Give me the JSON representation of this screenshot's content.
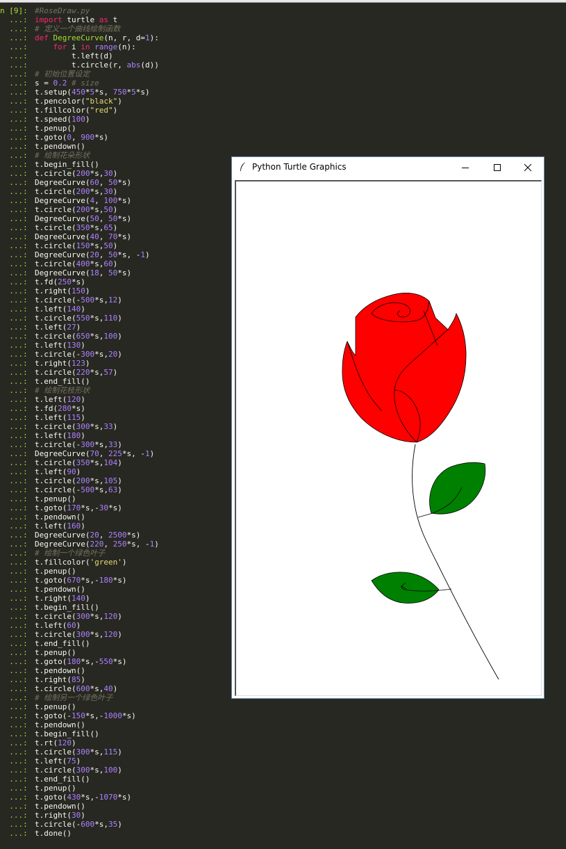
{
  "console": {
    "first_prompt": "n [9]:",
    "cont_prompt": "...:",
    "lines": [
      [
        [
          "com",
          "#RoseDraw.py"
        ]
      ],
      [
        [
          "kw",
          "import"
        ],
        [
          "txt",
          " turtle "
        ],
        [
          "kw",
          "as"
        ],
        [
          "txt",
          " t"
        ]
      ],
      [
        [
          "com",
          "# 定义一个曲线绘制函数"
        ]
      ],
      [
        [
          "kw",
          "def"
        ],
        [
          "txt",
          " "
        ],
        [
          "fn",
          "DegreeCurve"
        ],
        [
          "txt",
          "(n, r, d="
        ],
        [
          "num",
          "1"
        ],
        [
          "txt",
          "):"
        ]
      ],
      [
        [
          "txt",
          "    "
        ],
        [
          "kw",
          "for"
        ],
        [
          "txt",
          " i "
        ],
        [
          "kw",
          "in"
        ],
        [
          "txt",
          " "
        ],
        [
          "bi",
          "range"
        ],
        [
          "txt",
          "(n):"
        ]
      ],
      [
        [
          "txt",
          "        t.left(d)"
        ]
      ],
      [
        [
          "txt",
          "        t.circle(r, "
        ],
        [
          "bi",
          "abs"
        ],
        [
          "txt",
          "(d))"
        ]
      ],
      [
        [
          "com",
          "# 初始位置设定"
        ]
      ],
      [
        [
          "txt",
          "s = "
        ],
        [
          "num",
          "0.2"
        ],
        [
          "txt",
          " "
        ],
        [
          "com",
          "# size"
        ]
      ],
      [
        [
          "txt",
          "t.setup("
        ],
        [
          "num",
          "450"
        ],
        [
          "txt",
          "*"
        ],
        [
          "num",
          "5"
        ],
        [
          "txt",
          "*s, "
        ],
        [
          "num",
          "750"
        ],
        [
          "txt",
          "*"
        ],
        [
          "num",
          "5"
        ],
        [
          "txt",
          "*s)"
        ]
      ],
      [
        [
          "txt",
          "t.pencolor("
        ],
        [
          "str",
          "\"black\""
        ],
        [
          "txt",
          ")"
        ]
      ],
      [
        [
          "txt",
          "t.fillcolor("
        ],
        [
          "str",
          "\"red\""
        ],
        [
          "txt",
          ")"
        ]
      ],
      [
        [
          "txt",
          "t.speed("
        ],
        [
          "num",
          "100"
        ],
        [
          "txt",
          ")"
        ]
      ],
      [
        [
          "txt",
          "t.penup()"
        ]
      ],
      [
        [
          "txt",
          "t.goto("
        ],
        [
          "num",
          "0"
        ],
        [
          "txt",
          ", "
        ],
        [
          "num",
          "900"
        ],
        [
          "txt",
          "*s)"
        ]
      ],
      [
        [
          "txt",
          "t.pendown()"
        ]
      ],
      [
        [
          "com",
          "# 绘制花朵形状"
        ]
      ],
      [
        [
          "txt",
          "t.begin_fill()"
        ]
      ],
      [
        [
          "txt",
          "t.circle("
        ],
        [
          "num",
          "200"
        ],
        [
          "txt",
          "*s,"
        ],
        [
          "num",
          "30"
        ],
        [
          "txt",
          ")"
        ]
      ],
      [
        [
          "txt",
          "DegreeCurve("
        ],
        [
          "num",
          "60"
        ],
        [
          "txt",
          ", "
        ],
        [
          "num",
          "50"
        ],
        [
          "txt",
          "*s)"
        ]
      ],
      [
        [
          "txt",
          "t.circle("
        ],
        [
          "num",
          "200"
        ],
        [
          "txt",
          "*s,"
        ],
        [
          "num",
          "30"
        ],
        [
          "txt",
          ")"
        ]
      ],
      [
        [
          "txt",
          "DegreeCurve("
        ],
        [
          "num",
          "4"
        ],
        [
          "txt",
          ", "
        ],
        [
          "num",
          "100"
        ],
        [
          "txt",
          "*s)"
        ]
      ],
      [
        [
          "txt",
          "t.circle("
        ],
        [
          "num",
          "200"
        ],
        [
          "txt",
          "*s,"
        ],
        [
          "num",
          "50"
        ],
        [
          "txt",
          ")"
        ]
      ],
      [
        [
          "txt",
          "DegreeCurve("
        ],
        [
          "num",
          "50"
        ],
        [
          "txt",
          ", "
        ],
        [
          "num",
          "50"
        ],
        [
          "txt",
          "*s)"
        ]
      ],
      [
        [
          "txt",
          "t.circle("
        ],
        [
          "num",
          "350"
        ],
        [
          "txt",
          "*s,"
        ],
        [
          "num",
          "65"
        ],
        [
          "txt",
          ")"
        ]
      ],
      [
        [
          "txt",
          "DegreeCurve("
        ],
        [
          "num",
          "40"
        ],
        [
          "txt",
          ", "
        ],
        [
          "num",
          "70"
        ],
        [
          "txt",
          "*s)"
        ]
      ],
      [
        [
          "txt",
          "t.circle("
        ],
        [
          "num",
          "150"
        ],
        [
          "txt",
          "*s,"
        ],
        [
          "num",
          "50"
        ],
        [
          "txt",
          ")"
        ]
      ],
      [
        [
          "txt",
          "DegreeCurve("
        ],
        [
          "num",
          "20"
        ],
        [
          "txt",
          ", "
        ],
        [
          "num",
          "50"
        ],
        [
          "txt",
          "*s, -"
        ],
        [
          "num",
          "1"
        ],
        [
          "txt",
          ")"
        ]
      ],
      [
        [
          "txt",
          "t.circle("
        ],
        [
          "num",
          "400"
        ],
        [
          "txt",
          "*s,"
        ],
        [
          "num",
          "60"
        ],
        [
          "txt",
          ")"
        ]
      ],
      [
        [
          "txt",
          "DegreeCurve("
        ],
        [
          "num",
          "18"
        ],
        [
          "txt",
          ", "
        ],
        [
          "num",
          "50"
        ],
        [
          "txt",
          "*s)"
        ]
      ],
      [
        [
          "txt",
          "t.fd("
        ],
        [
          "num",
          "250"
        ],
        [
          "txt",
          "*s)"
        ]
      ],
      [
        [
          "txt",
          "t.right("
        ],
        [
          "num",
          "150"
        ],
        [
          "txt",
          ")"
        ]
      ],
      [
        [
          "txt",
          "t.circle(-"
        ],
        [
          "num",
          "500"
        ],
        [
          "txt",
          "*s,"
        ],
        [
          "num",
          "12"
        ],
        [
          "txt",
          ")"
        ]
      ],
      [
        [
          "txt",
          "t.left("
        ],
        [
          "num",
          "140"
        ],
        [
          "txt",
          ")"
        ]
      ],
      [
        [
          "txt",
          "t.circle("
        ],
        [
          "num",
          "550"
        ],
        [
          "txt",
          "*s,"
        ],
        [
          "num",
          "110"
        ],
        [
          "txt",
          ")"
        ]
      ],
      [
        [
          "txt",
          "t.left("
        ],
        [
          "num",
          "27"
        ],
        [
          "txt",
          ")"
        ]
      ],
      [
        [
          "txt",
          "t.circle("
        ],
        [
          "num",
          "650"
        ],
        [
          "txt",
          "*s,"
        ],
        [
          "num",
          "100"
        ],
        [
          "txt",
          ")"
        ]
      ],
      [
        [
          "txt",
          "t.left("
        ],
        [
          "num",
          "130"
        ],
        [
          "txt",
          ")"
        ]
      ],
      [
        [
          "txt",
          "t.circle(-"
        ],
        [
          "num",
          "300"
        ],
        [
          "txt",
          "*s,"
        ],
        [
          "num",
          "20"
        ],
        [
          "txt",
          ")"
        ]
      ],
      [
        [
          "txt",
          "t.right("
        ],
        [
          "num",
          "123"
        ],
        [
          "txt",
          ")"
        ]
      ],
      [
        [
          "txt",
          "t.circle("
        ],
        [
          "num",
          "220"
        ],
        [
          "txt",
          "*s,"
        ],
        [
          "num",
          "57"
        ],
        [
          "txt",
          ")"
        ]
      ],
      [
        [
          "txt",
          "t.end_fill()"
        ]
      ],
      [
        [
          "com",
          "# 绘制花枝形状"
        ]
      ],
      [
        [
          "txt",
          "t.left("
        ],
        [
          "num",
          "120"
        ],
        [
          "txt",
          ")"
        ]
      ],
      [
        [
          "txt",
          "t.fd("
        ],
        [
          "num",
          "280"
        ],
        [
          "txt",
          "*s)"
        ]
      ],
      [
        [
          "txt",
          "t.left("
        ],
        [
          "num",
          "115"
        ],
        [
          "txt",
          ")"
        ]
      ],
      [
        [
          "txt",
          "t.circle("
        ],
        [
          "num",
          "300"
        ],
        [
          "txt",
          "*s,"
        ],
        [
          "num",
          "33"
        ],
        [
          "txt",
          ")"
        ]
      ],
      [
        [
          "txt",
          "t.left("
        ],
        [
          "num",
          "180"
        ],
        [
          "txt",
          ")"
        ]
      ],
      [
        [
          "txt",
          "t.circle(-"
        ],
        [
          "num",
          "300"
        ],
        [
          "txt",
          "*s,"
        ],
        [
          "num",
          "33"
        ],
        [
          "txt",
          ")"
        ]
      ],
      [
        [
          "txt",
          "DegreeCurve("
        ],
        [
          "num",
          "70"
        ],
        [
          "txt",
          ", "
        ],
        [
          "num",
          "225"
        ],
        [
          "txt",
          "*s, -"
        ],
        [
          "num",
          "1"
        ],
        [
          "txt",
          ")"
        ]
      ],
      [
        [
          "txt",
          "t.circle("
        ],
        [
          "num",
          "350"
        ],
        [
          "txt",
          "*s,"
        ],
        [
          "num",
          "104"
        ],
        [
          "txt",
          ")"
        ]
      ],
      [
        [
          "txt",
          "t.left("
        ],
        [
          "num",
          "90"
        ],
        [
          "txt",
          ")"
        ]
      ],
      [
        [
          "txt",
          "t.circle("
        ],
        [
          "num",
          "200"
        ],
        [
          "txt",
          "*s,"
        ],
        [
          "num",
          "105"
        ],
        [
          "txt",
          ")"
        ]
      ],
      [
        [
          "txt",
          "t.circle(-"
        ],
        [
          "num",
          "500"
        ],
        [
          "txt",
          "*s,"
        ],
        [
          "num",
          "63"
        ],
        [
          "txt",
          ")"
        ]
      ],
      [
        [
          "txt",
          "t.penup()"
        ]
      ],
      [
        [
          "txt",
          "t.goto("
        ],
        [
          "num",
          "170"
        ],
        [
          "txt",
          "*s,-"
        ],
        [
          "num",
          "30"
        ],
        [
          "txt",
          "*s)"
        ]
      ],
      [
        [
          "txt",
          "t.pendown()"
        ]
      ],
      [
        [
          "txt",
          "t.left("
        ],
        [
          "num",
          "160"
        ],
        [
          "txt",
          ")"
        ]
      ],
      [
        [
          "txt",
          "DegreeCurve("
        ],
        [
          "num",
          "20"
        ],
        [
          "txt",
          ", "
        ],
        [
          "num",
          "2500"
        ],
        [
          "txt",
          "*s)"
        ]
      ],
      [
        [
          "txt",
          "DegreeCurve("
        ],
        [
          "num",
          "220"
        ],
        [
          "txt",
          ", "
        ],
        [
          "num",
          "250"
        ],
        [
          "txt",
          "*s, -"
        ],
        [
          "num",
          "1"
        ],
        [
          "txt",
          ")"
        ]
      ],
      [
        [
          "com",
          "# 绘制一个绿色叶子"
        ]
      ],
      [
        [
          "txt",
          "t.fillcolor("
        ],
        [
          "str",
          "'green'"
        ],
        [
          "txt",
          ")"
        ]
      ],
      [
        [
          "txt",
          "t.penup()"
        ]
      ],
      [
        [
          "txt",
          "t.goto("
        ],
        [
          "num",
          "670"
        ],
        [
          "txt",
          "*s,-"
        ],
        [
          "num",
          "180"
        ],
        [
          "txt",
          "*s)"
        ]
      ],
      [
        [
          "txt",
          "t.pendown()"
        ]
      ],
      [
        [
          "txt",
          "t.right("
        ],
        [
          "num",
          "140"
        ],
        [
          "txt",
          ")"
        ]
      ],
      [
        [
          "txt",
          "t.begin_fill()"
        ]
      ],
      [
        [
          "txt",
          "t.circle("
        ],
        [
          "num",
          "300"
        ],
        [
          "txt",
          "*s,"
        ],
        [
          "num",
          "120"
        ],
        [
          "txt",
          ")"
        ]
      ],
      [
        [
          "txt",
          "t.left("
        ],
        [
          "num",
          "60"
        ],
        [
          "txt",
          ")"
        ]
      ],
      [
        [
          "txt",
          "t.circle("
        ],
        [
          "num",
          "300"
        ],
        [
          "txt",
          "*s,"
        ],
        [
          "num",
          "120"
        ],
        [
          "txt",
          ")"
        ]
      ],
      [
        [
          "txt",
          "t.end_fill()"
        ]
      ],
      [
        [
          "txt",
          "t.penup()"
        ]
      ],
      [
        [
          "txt",
          "t.goto("
        ],
        [
          "num",
          "180"
        ],
        [
          "txt",
          "*s,-"
        ],
        [
          "num",
          "550"
        ],
        [
          "txt",
          "*s)"
        ]
      ],
      [
        [
          "txt",
          "t.pendown()"
        ]
      ],
      [
        [
          "txt",
          "t.right("
        ],
        [
          "num",
          "85"
        ],
        [
          "txt",
          ")"
        ]
      ],
      [
        [
          "txt",
          "t.circle("
        ],
        [
          "num",
          "600"
        ],
        [
          "txt",
          "*s,"
        ],
        [
          "num",
          "40"
        ],
        [
          "txt",
          ")"
        ]
      ],
      [
        [
          "com",
          "# 绘制另一个绿色叶子"
        ]
      ],
      [
        [
          "txt",
          "t.penup()"
        ]
      ],
      [
        [
          "txt",
          "t.goto(-"
        ],
        [
          "num",
          "150"
        ],
        [
          "txt",
          "*s,-"
        ],
        [
          "num",
          "1000"
        ],
        [
          "txt",
          "*s)"
        ]
      ],
      [
        [
          "txt",
          "t.pendown()"
        ]
      ],
      [
        [
          "txt",
          "t.begin_fill()"
        ]
      ],
      [
        [
          "txt",
          "t.rt("
        ],
        [
          "num",
          "120"
        ],
        [
          "txt",
          ")"
        ]
      ],
      [
        [
          "txt",
          "t.circle("
        ],
        [
          "num",
          "300"
        ],
        [
          "txt",
          "*s,"
        ],
        [
          "num",
          "115"
        ],
        [
          "txt",
          ")"
        ]
      ],
      [
        [
          "txt",
          "t.left("
        ],
        [
          "num",
          "75"
        ],
        [
          "txt",
          ")"
        ]
      ],
      [
        [
          "txt",
          "t.circle("
        ],
        [
          "num",
          "300"
        ],
        [
          "txt",
          "*s,"
        ],
        [
          "num",
          "100"
        ],
        [
          "txt",
          ")"
        ]
      ],
      [
        [
          "txt",
          "t.end_fill()"
        ]
      ],
      [
        [
          "txt",
          "t.penup()"
        ]
      ],
      [
        [
          "txt",
          "t.goto("
        ],
        [
          "num",
          "430"
        ],
        [
          "txt",
          "*s,-"
        ],
        [
          "num",
          "1070"
        ],
        [
          "txt",
          "*s)"
        ]
      ],
      [
        [
          "txt",
          "t.pendown()"
        ]
      ],
      [
        [
          "txt",
          "t.right("
        ],
        [
          "num",
          "30"
        ],
        [
          "txt",
          ")"
        ]
      ],
      [
        [
          "txt",
          "t.circle(-"
        ],
        [
          "num",
          "600"
        ],
        [
          "txt",
          "*s,"
        ],
        [
          "num",
          "35"
        ],
        [
          "txt",
          ")"
        ]
      ],
      [
        [
          "txt",
          "t.done()"
        ]
      ]
    ]
  },
  "window": {
    "title": "Python Turtle Graphics",
    "icon": "feather-icon",
    "controls": [
      "minimize-icon",
      "maximize-icon",
      "close-icon"
    ]
  },
  "drawing": {
    "flower_color": "#ff0000",
    "leaf_color": "#008000",
    "line_color": "#000000"
  }
}
